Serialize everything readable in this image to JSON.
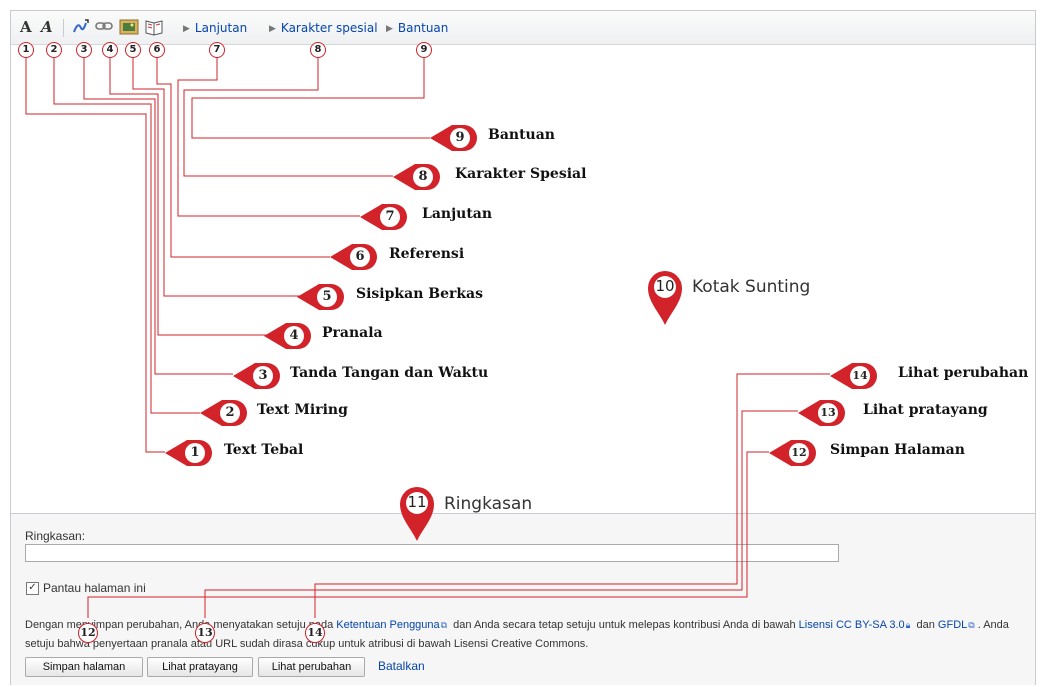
{
  "toolbar": {
    "bold_label": "A",
    "italic_label": "A",
    "tabs": [
      "Lanjutan",
      "Karakter spesial",
      "Bantuan"
    ]
  },
  "top_numbers": [
    "1",
    "2",
    "3",
    "4",
    "5",
    "6",
    "7",
    "8",
    "9"
  ],
  "callouts": [
    {
      "num": "9",
      "label": "Bantuan"
    },
    {
      "num": "8",
      "label": "Karakter Spesial"
    },
    {
      "num": "7",
      "label": "Lanjutan"
    },
    {
      "num": "6",
      "label": "Referensi"
    },
    {
      "num": "5",
      "label": "Sisipkan Berkas"
    },
    {
      "num": "4",
      "label": "Pranala"
    },
    {
      "num": "3",
      "label": "Tanda Tangan dan Waktu"
    },
    {
      "num": "2",
      "label": "Text Miring"
    },
    {
      "num": "1",
      "label": "Text Tebal"
    },
    {
      "num": "14",
      "label": "Lihat perubahan"
    },
    {
      "num": "13",
      "label": "Lihat pratayang"
    },
    {
      "num": "12",
      "label": "Simpan Halaman"
    }
  ],
  "pins": [
    {
      "num": "10",
      "label": "Kotak Sunting"
    },
    {
      "num": "11",
      "label": "Ringkasan"
    }
  ],
  "summary": {
    "label": "Ringkasan:",
    "value": ""
  },
  "watch": {
    "checked": "✓",
    "label": "Pantau halaman ini"
  },
  "notice": {
    "t1": "Dengan menyimpan perubahan, Anda menyatakan setuju pada ",
    "l1": "Ketentuan Pengguna",
    "t2": " dan Anda secara tetap setuju untuk melepas kontribusi Anda di bawah ",
    "l2": "Lisensi CC BY-SA 3.0",
    "t3": " dan ",
    "l3": "GFDL",
    "t4": ". Anda setuju bahwa penyertaan pranala atau URL sudah dirasa cukup untuk atribusi di bawah Lisensi Creative Commons."
  },
  "buttons": {
    "save": "Simpan halaman",
    "preview": "Lihat pratayang",
    "diff": "Lihat perubahan",
    "cancel": "Batalkan"
  },
  "bottom_numbers": [
    "12",
    "13",
    "14"
  ],
  "colors": {
    "accent": "#d2232a",
    "link": "#0645ad"
  }
}
